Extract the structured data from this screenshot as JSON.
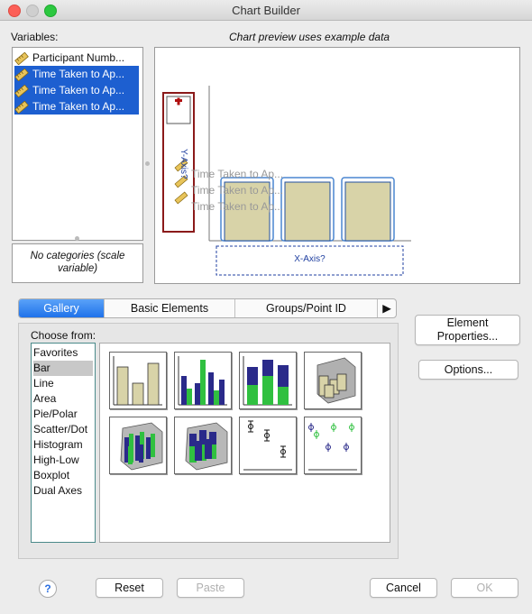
{
  "window": {
    "title": "Chart Builder"
  },
  "variables": {
    "label": "Variables:",
    "items": [
      {
        "label": "Participant Numb...",
        "selected": false,
        "icon": "ruler-icon"
      },
      {
        "label": "Time Taken to Ap...",
        "selected": true,
        "icon": "ruler-icon"
      },
      {
        "label": "Time Taken to Ap...",
        "selected": true,
        "icon": "ruler-icon"
      },
      {
        "label": "Time Taken to Ap...",
        "selected": true,
        "icon": "ruler-icon"
      }
    ],
    "no_categories": "No categories (scale variable)"
  },
  "preview": {
    "header": "Chart preview uses example data",
    "y_axis": "Y-Axis?",
    "x_axis": "X-Axis?",
    "dropped_vars": [
      "Time Taken to Ap...",
      "Time Taken to Ap...",
      "Time Taken to Ap..."
    ],
    "colors": {
      "bar_fill": "#d8d3a8",
      "highlight": "#4a86d0",
      "drop_zone": "#8b1a1a"
    }
  },
  "tabs": [
    {
      "label": "Gallery",
      "active": true
    },
    {
      "label": "Basic Elements",
      "active": false
    },
    {
      "label": "Groups/Point ID",
      "active": false
    }
  ],
  "gallery": {
    "choose_from": "Choose from:",
    "categories": [
      "Favorites",
      "Bar",
      "Line",
      "Area",
      "Pie/Polar",
      "Scatter/Dot",
      "Histogram",
      "High-Low",
      "Boxplot",
      "Dual Axes"
    ],
    "selected_category": "Bar",
    "thumbnails": [
      "simple-bar-icon",
      "clustered-bar-icon",
      "stacked-bar-icon",
      "3d-bar-icon",
      "3d-clustered-bar-icon",
      "3d-stacked-bar-icon",
      "error-bar-icon",
      "clustered-error-bar-icon"
    ]
  },
  "side_buttons": {
    "element_properties": "Element Properties...",
    "options": "Options..."
  },
  "footer": {
    "help": "?",
    "reset": "Reset",
    "paste": "Paste",
    "cancel": "Cancel",
    "ok": "OK"
  }
}
